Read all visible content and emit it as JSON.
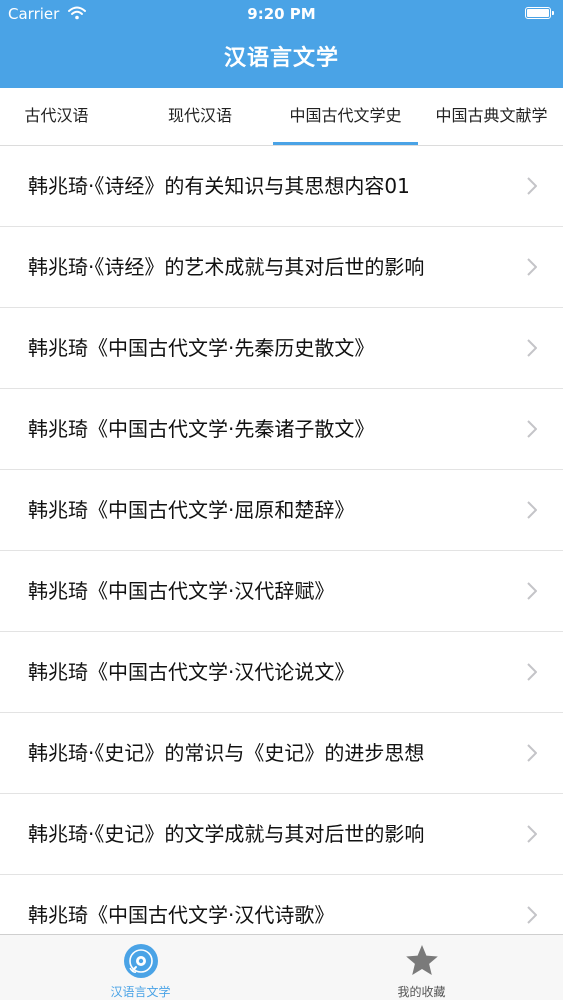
{
  "status_bar": {
    "carrier": "Carrier",
    "time": "9:20 PM",
    "battery_level": 1.0
  },
  "nav": {
    "title": "汉语言文学"
  },
  "tabs": [
    {
      "label": "古代汉语"
    },
    {
      "label": "现代汉语"
    },
    {
      "label": "中国古代文学史",
      "selected": true
    },
    {
      "label": "中国古典文献学"
    }
  ],
  "list": {
    "items": [
      {
        "label": "韩兆琦·《诗经》的有关知识与其思想内容01"
      },
      {
        "label": "韩兆琦·《诗经》的艺术成就与其对后世的影响"
      },
      {
        "label": "韩兆琦《中国古代文学·先秦历史散文》"
      },
      {
        "label": "韩兆琦《中国古代文学·先秦诸子散文》"
      },
      {
        "label": "韩兆琦《中国古代文学·屈原和楚辞》"
      },
      {
        "label": "韩兆琦《中国古代文学·汉代辞赋》"
      },
      {
        "label": "韩兆琦《中国古代文学·汉代论说文》"
      },
      {
        "label": "韩兆琦·《史记》的常识与《史记》的进步思想"
      },
      {
        "label": "韩兆琦·《史记》的文学成就与其对后世的影响"
      },
      {
        "label": "韩兆琦《中国古代文学·汉代诗歌》"
      }
    ]
  },
  "tabbar": {
    "items": [
      {
        "label": "汉语言文学",
        "icon": "disc-icon",
        "active": true
      },
      {
        "label": "我的收藏",
        "icon": "star-icon",
        "active": false
      }
    ]
  },
  "colors": {
    "accent": "#4aa3e6",
    "inactive": "#555555",
    "divider": "#e3e3e3"
  }
}
